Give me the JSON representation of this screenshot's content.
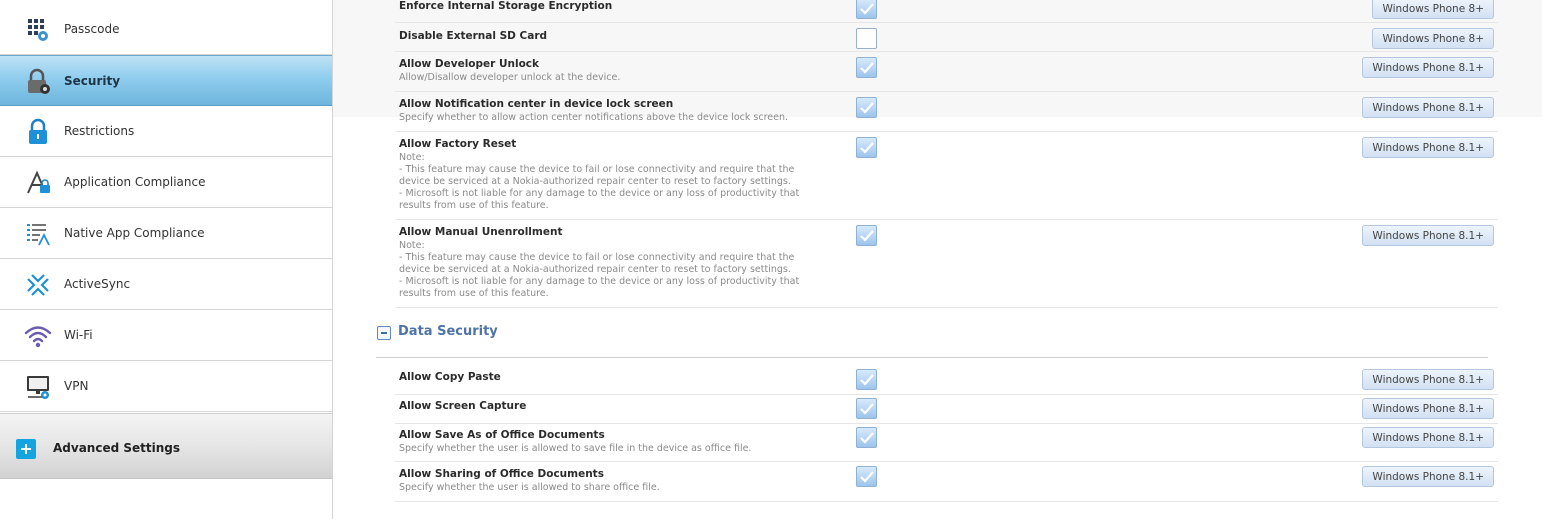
{
  "sidebar": {
    "items": [
      {
        "label": "Passcode",
        "icon": "passcode-keypad-icon"
      },
      {
        "label": "Security",
        "icon": "security-lock-gear-icon"
      },
      {
        "label": "Restrictions",
        "icon": "restrictions-lock-icon"
      },
      {
        "label": "Application Compliance",
        "icon": "application-compliance-icon"
      },
      {
        "label": "Native App Compliance",
        "icon": "native-app-compliance-icon"
      },
      {
        "label": "ActiveSync",
        "icon": "activesync-icon"
      },
      {
        "label": "Wi-Fi",
        "icon": "wifi-icon"
      },
      {
        "label": "VPN",
        "icon": "vpn-monitor-icon"
      }
    ],
    "active": "Security",
    "advanced_label": "Advanced Settings"
  },
  "settings": [
    {
      "title": "Enforce Internal Storage Encryption",
      "desc": [],
      "checked": true,
      "platform": "Windows Phone 8+"
    },
    {
      "title": "Disable External SD Card",
      "desc": [],
      "checked": false,
      "platform": "Windows Phone 8+"
    },
    {
      "title": "Allow Developer Unlock",
      "desc": [
        "Allow/Disallow developer unlock at the device."
      ],
      "checked": true,
      "platform": "Windows Phone 8.1+"
    },
    {
      "title": "Allow Notification center in device lock screen",
      "desc": [
        "Specify whether to allow action center notifications above the device lock screen."
      ],
      "checked": true,
      "platform": "Windows Phone 8.1+"
    },
    {
      "title": "Allow Factory Reset",
      "desc": [
        "Note:",
        "- This feature may cause the device to fail or lose connectivity and require that the",
        "device be serviced at a Nokia-authorized repair center to reset to factory settings.",
        "- Microsoft is not liable for any damage to the device or any loss of productivity that",
        "results from use of this feature."
      ],
      "checked": true,
      "platform": "Windows Phone 8.1+"
    },
    {
      "title": "Allow Manual Unenrollment",
      "desc": [
        "Note:",
        "- This feature may cause the device to fail or lose connectivity and require that the",
        "device be serviced at a Nokia-authorized repair center to reset to factory settings.",
        "- Microsoft is not liable for any damage to the device or any loss of productivity that",
        "results from use of this feature."
      ],
      "checked": true,
      "platform": "Windows Phone 8.1+"
    }
  ],
  "data_security": {
    "title": "Data Security",
    "settings": [
      {
        "title": "Allow Copy Paste",
        "desc": [],
        "checked": true,
        "platform": "Windows Phone 8.1+"
      },
      {
        "title": "Allow Screen Capture",
        "desc": [],
        "checked": true,
        "platform": "Windows Phone 8.1+"
      },
      {
        "title": "Allow Save As of Office Documents",
        "desc": [
          "Specify whether the user is allowed to save file in the device as office file."
        ],
        "checked": true,
        "platform": "Windows Phone 8.1+"
      },
      {
        "title": "Allow Sharing of Office Documents",
        "desc": [
          "Specify whether the user is allowed to share office file."
        ],
        "checked": true,
        "platform": "Windows Phone 8.1+"
      }
    ]
  },
  "colors": {
    "accent": "#14a5e0",
    "active_nav": "#8fcdee",
    "section_title": "#4f73a5"
  }
}
